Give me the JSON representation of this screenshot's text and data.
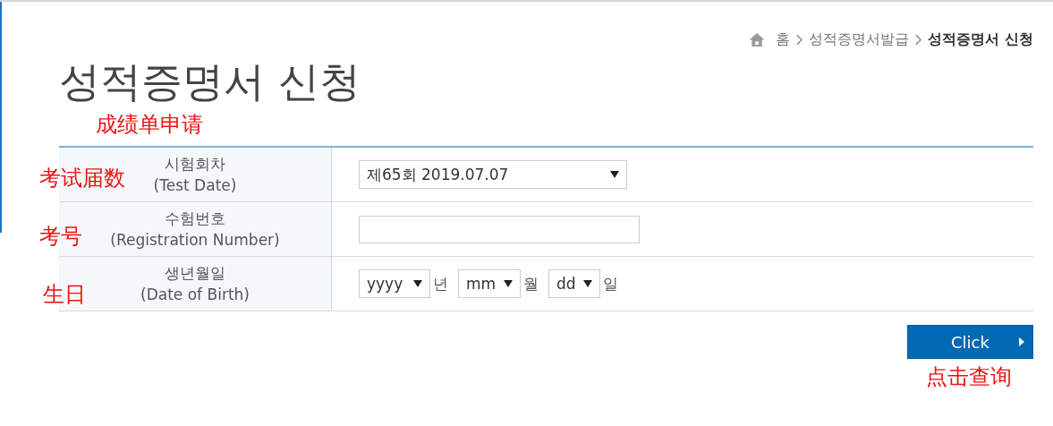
{
  "breadcrumb": [
    {
      "label": "홈",
      "current": false
    },
    {
      "label": "성적증명서발급",
      "current": false
    },
    {
      "label": "성적증명서 신청",
      "current": true
    }
  ],
  "title": "성적증명서 신청",
  "title_note": "成绩单申请",
  "form_rows": [
    {
      "label": "시험회차",
      "label_en": "(Test Date)",
      "note": "考试届数",
      "kind": "select",
      "value": "제65회 2019.07.07"
    },
    {
      "label": "수험번호",
      "label_en": "(Registration Number)",
      "note": "考号",
      "kind": "input"
    },
    {
      "label": "생년월일",
      "label_en": "(Date of Birth)",
      "note": "生日",
      "kind": "date",
      "parts": [
        {
          "value": "yyyy",
          "unit": "년"
        },
        {
          "value": "mm",
          "unit": "월"
        },
        {
          "value": "dd",
          "unit": "일"
        }
      ]
    }
  ],
  "submit": {
    "label": "Click",
    "note": "点击查询"
  }
}
